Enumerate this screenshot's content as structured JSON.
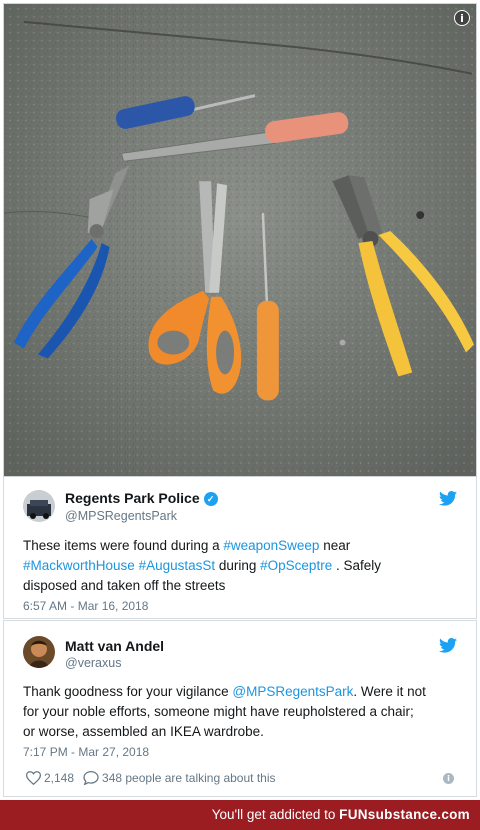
{
  "tweet1": {
    "name": "Regents Park Police",
    "handle": "@MPSRegentsPark",
    "text_pre": "These items were found during a ",
    "tag_weapon": "#weaponSweep",
    "text_near": " near",
    "tag_mackworth": "#MackworthHouse",
    "tag_augustas": "#AugustasSt",
    "text_during": " during ",
    "tag_op": "#OpSceptre",
    "text_post": " . Safely",
    "text_line3": "disposed and taken off the streets",
    "timestamp": "6:57 AM - Mar 16, 2018"
  },
  "tweet2": {
    "name": "Matt van Andel",
    "handle": "@veraxus",
    "text_pre": "Thank goodness for your vigilance ",
    "mention": "@MPSRegentsPark",
    "text_post": ". Were it not",
    "text_line2": "for your noble efforts, someone might have reupholstered a chair;",
    "text_line3": "or worse, assembled an IKEA wardrobe.",
    "timestamp": "7:17 PM - Mar 27, 2018",
    "likes": "2,148",
    "talking": "348 people are talking about this"
  },
  "footer": {
    "prefix": "You'll get addicted to ",
    "brand": "FUNsubstance.com"
  },
  "colors": {
    "link": "#1b95e0",
    "verified": "#1da1f2",
    "footer_bg": "#9b1d21"
  }
}
